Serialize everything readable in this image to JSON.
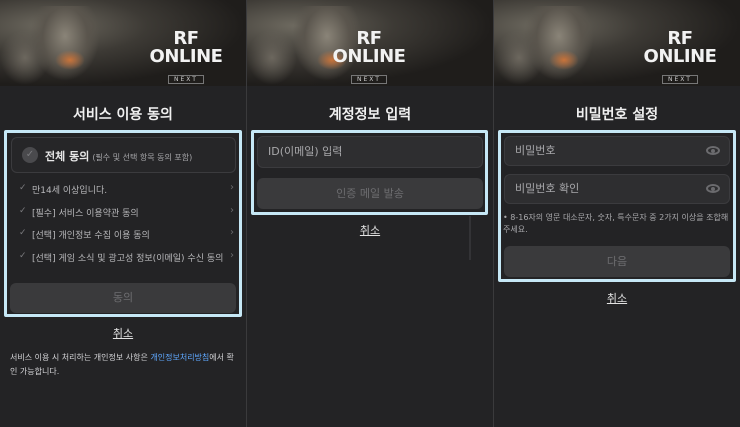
{
  "brand": {
    "logo_main": "RF ONLINE",
    "logo_sub": "NEXT"
  },
  "panel_terms": {
    "title": "서비스 이용 동의",
    "agree_all_label": "전체 동의",
    "agree_all_note": "(필수 및 선택 항목 동의 포함)",
    "terms": [
      {
        "label": "만14세 이상입니다."
      },
      {
        "label": "[필수] 서비스 이용약관 동의"
      },
      {
        "label": "[선택] 개인정보 수집 이용 동의"
      },
      {
        "label": "[선택] 게임 소식 및 광고성 정보(이메일) 수신 동의"
      }
    ],
    "agree_button": "동의",
    "cancel": "취소",
    "notice_pre": "서비스 이용 시 처리하는 개인정보 사항은 ",
    "notice_link": "개인정보처리방침",
    "notice_post": "에서 확인 가능합니다."
  },
  "panel_account": {
    "title": "계정정보 입력",
    "id_placeholder": "ID(이메일) 입력",
    "send_button": "인증 메일 발송",
    "cancel": "취소"
  },
  "panel_password": {
    "title": "비밀번호 설정",
    "password_placeholder": "비밀번호",
    "confirm_placeholder": "비밀번호 확인",
    "hint": "8-16자의 영문 대소문자, 숫자, 특수문자 중 2가지 이상을 조합해 주세요.",
    "next_button": "다음",
    "cancel": "취소"
  },
  "icons": {
    "check": "check-icon",
    "chevron": "chevron-right-icon",
    "eye": "eye-icon"
  },
  "colors": {
    "highlight": "#c6e8f6",
    "link": "#5fa8ff"
  }
}
